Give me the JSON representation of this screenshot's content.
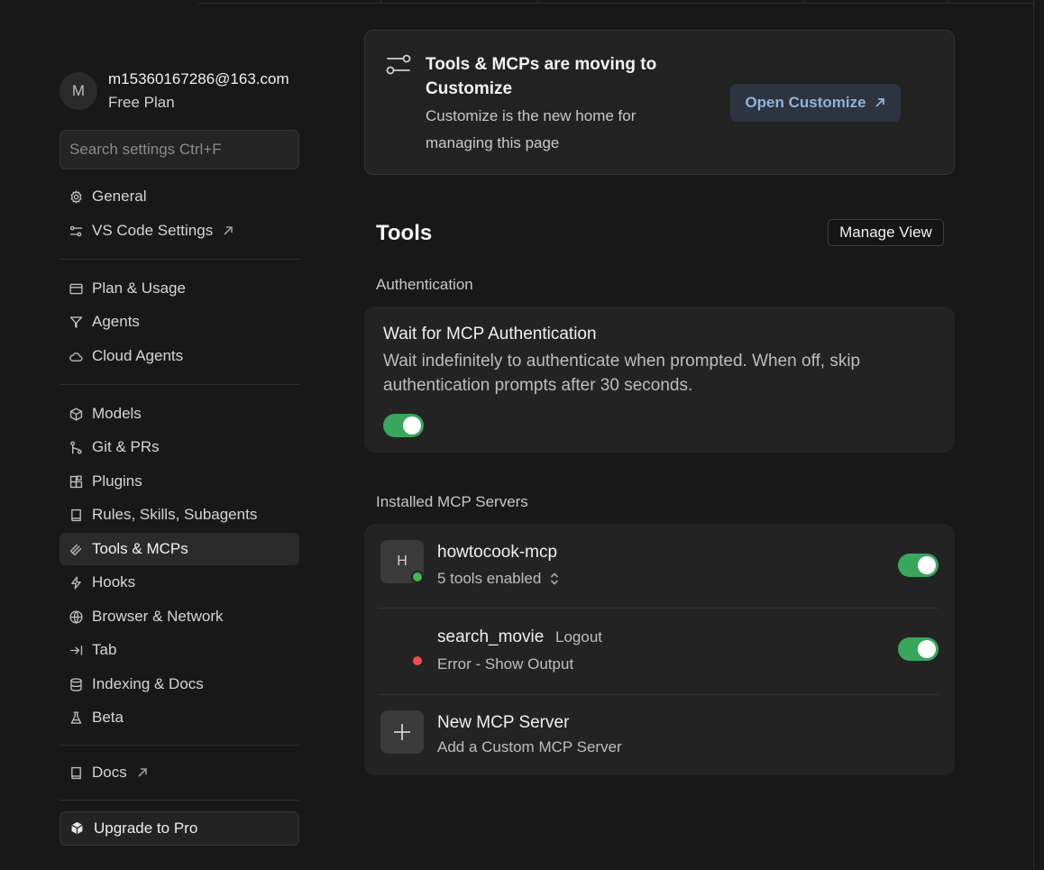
{
  "sidebar": {
    "profile": {
      "initial": "M",
      "email": "m15360167286@163.com",
      "plan": "Free Plan"
    },
    "search_placeholder": "Search settings Ctrl+F",
    "items": [
      {
        "label": "General",
        "icon": "gear-icon"
      },
      {
        "label": "VS Code Settings",
        "icon": "sliders-icon",
        "external": true
      },
      {
        "label": "Plan & Usage",
        "icon": "card-icon"
      },
      {
        "label": "Agents",
        "icon": "agents-icon"
      },
      {
        "label": "Cloud Agents",
        "icon": "cloud-icon"
      },
      {
        "label": "Models",
        "icon": "cube-icon"
      },
      {
        "label": "Git & PRs",
        "icon": "git-icon"
      },
      {
        "label": "Plugins",
        "icon": "puzzle-icon"
      },
      {
        "label": "Rules, Skills, Subagents",
        "icon": "book-icon"
      },
      {
        "label": "Tools & MCPs",
        "icon": "tools-icon",
        "active": true
      },
      {
        "label": "Hooks",
        "icon": "bolt-icon"
      },
      {
        "label": "Browser & Network",
        "icon": "globe-icon"
      },
      {
        "label": "Tab",
        "icon": "tab-icon"
      },
      {
        "label": "Indexing & Docs",
        "icon": "database-icon"
      },
      {
        "label": "Beta",
        "icon": "flask-icon"
      },
      {
        "label": "Docs",
        "icon": "book-icon",
        "external": true
      }
    ],
    "upgrade_label": "Upgrade to Pro"
  },
  "banner": {
    "title": "Tools & MCPs are moving to Customize",
    "description": "Customize is the new home for managing this page",
    "button_label": "Open Customize"
  },
  "tools": {
    "heading": "Tools",
    "manage_view_label": "Manage View",
    "authentication": {
      "section_label": "Authentication",
      "title": "Wait for MCP Authentication",
      "description": "Wait indefinitely to authenticate when prompted. When off, skip authentication prompts after 30 seconds.",
      "enabled": true
    },
    "installed": {
      "section_label": "Installed MCP Servers",
      "servers": [
        {
          "initial": "H",
          "name": "howtocook-mcp",
          "status_text": "5 tools enabled",
          "status_color": "#3fb950",
          "enabled": true
        },
        {
          "initial": "",
          "name": "search_movie",
          "action_label": "Logout",
          "status_text": "Error - Show Output",
          "status_color": "#f14c4c",
          "enabled": true
        }
      ],
      "new_server": {
        "title": "New MCP Server",
        "subtitle": "Add a Custom MCP Server"
      }
    }
  },
  "colors": {
    "accent_toggle": "#3aa55d",
    "link": "#8fb2d8",
    "background": "#181818"
  }
}
